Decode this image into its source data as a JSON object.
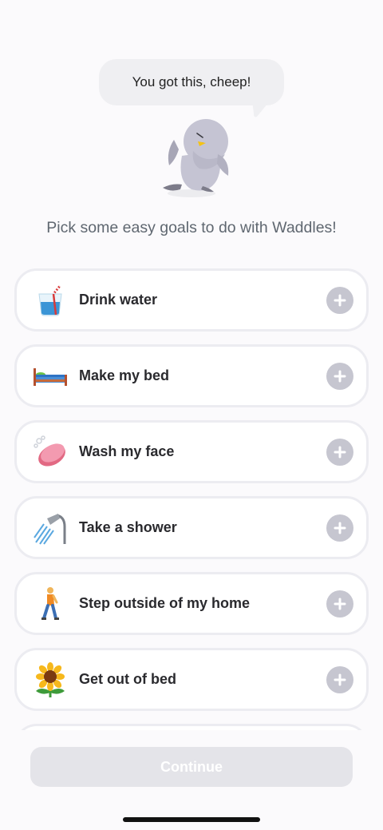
{
  "speech_bubble": "You got this, cheep!",
  "subtitle": "Pick some easy goals to do with Waddles!",
  "goals": [
    {
      "label": "Drink water",
      "icon": "water-glass-icon"
    },
    {
      "label": "Make my bed",
      "icon": "bed-icon"
    },
    {
      "label": "Wash my face",
      "icon": "soap-icon"
    },
    {
      "label": "Take a shower",
      "icon": "shower-icon"
    },
    {
      "label": "Step outside of my home",
      "icon": "walking-person-icon"
    },
    {
      "label": "Get out of bed",
      "icon": "sunflower-icon"
    }
  ],
  "continue_label": "Continue",
  "colors": {
    "background": "#fbfafc",
    "card_border": "#ececf1",
    "add_button": "#c6c6d0",
    "continue_disabled": "#e4e4e9"
  }
}
